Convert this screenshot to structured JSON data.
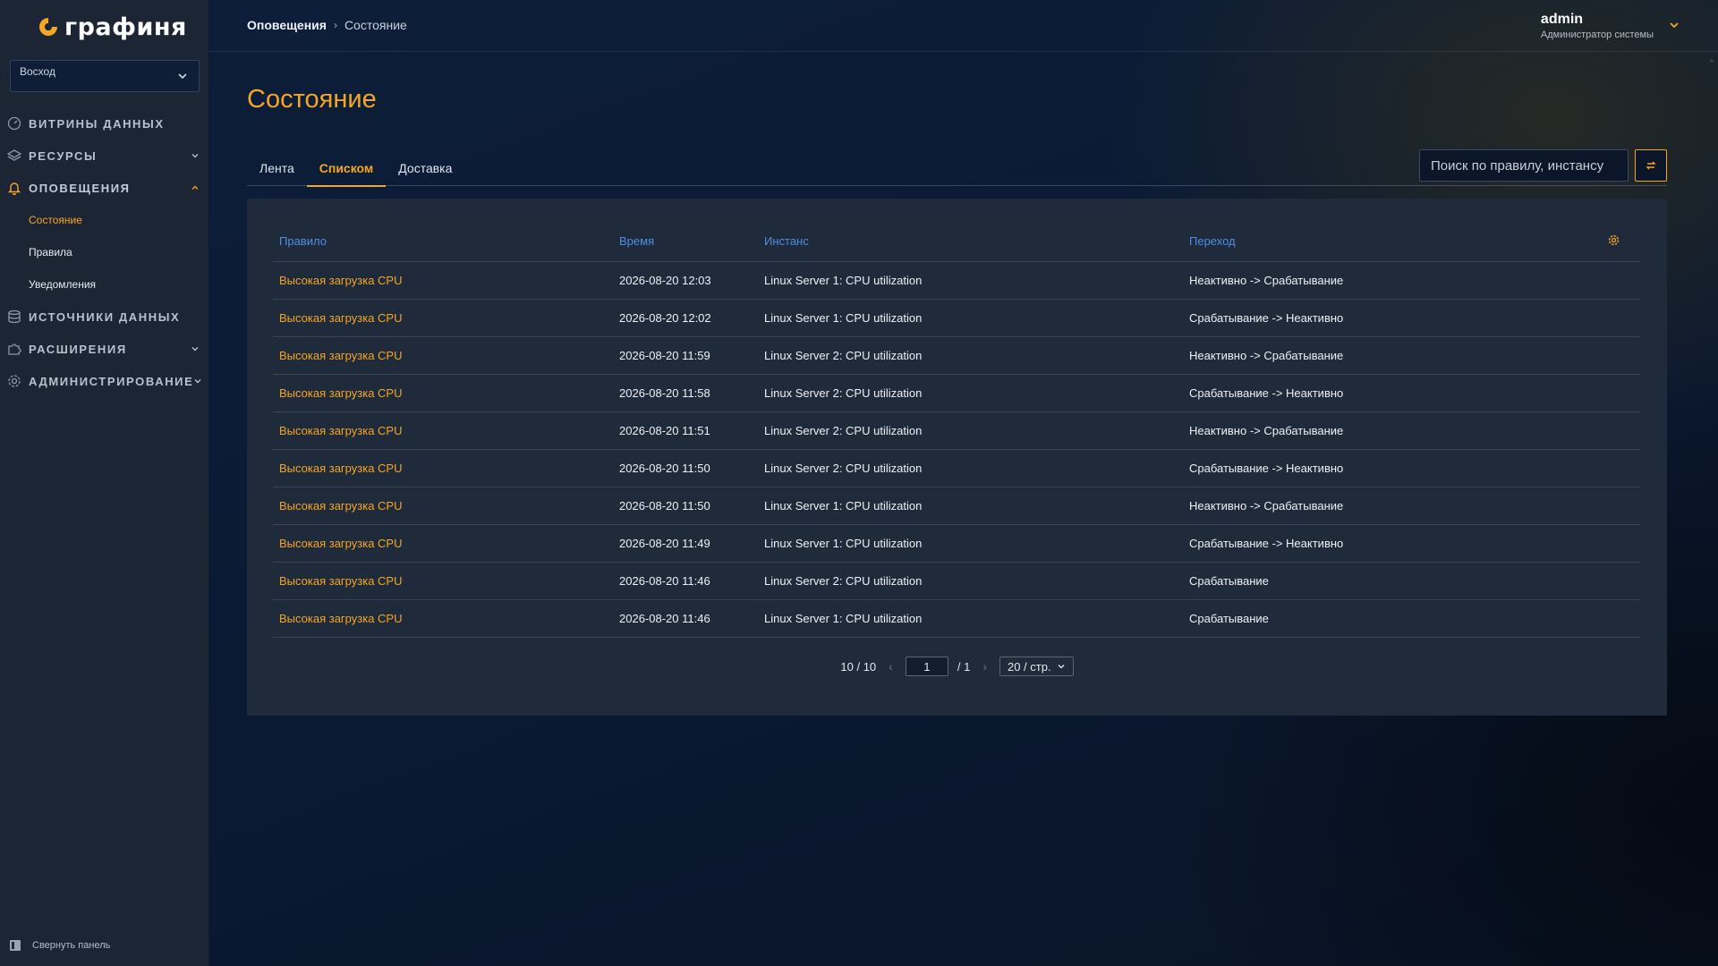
{
  "brand": {
    "logo_text": "графиня",
    "accent": "#f5a623"
  },
  "sidebar": {
    "org_select": {
      "value": "Восход"
    },
    "items": [
      {
        "label": "Витрины данных",
        "icon": "dashboard-icon",
        "expandable": false
      },
      {
        "label": "Ресурсы",
        "icon": "layers-icon",
        "expandable": true
      },
      {
        "label": "Оповещения",
        "icon": "bell-icon",
        "expandable": true,
        "expanded": true,
        "children": [
          {
            "label": "Состояние",
            "active": true
          },
          {
            "label": "Правила"
          },
          {
            "label": "Уведомления"
          }
        ]
      },
      {
        "label": "Источники данных",
        "icon": "database-icon",
        "expandable": false
      },
      {
        "label": "Расширения",
        "icon": "puzzle-icon",
        "expandable": true
      },
      {
        "label": "Администрирование",
        "icon": "gear-icon",
        "expandable": true
      }
    ],
    "collapse_label": "Свернуть панель"
  },
  "header": {
    "breadcrumb": [
      "Оповещения",
      "Состояние"
    ],
    "user": {
      "name": "admin",
      "role": "Администратор системы"
    }
  },
  "page": {
    "title": "Состояние",
    "tabs": [
      {
        "label": "Лента"
      },
      {
        "label": "Списком",
        "active": true
      },
      {
        "label": "Доставка"
      }
    ],
    "search_placeholder": "Поиск по правилу, инстансу"
  },
  "table": {
    "columns": [
      "Правило",
      "Время",
      "Инстанс",
      "Переход"
    ],
    "rows": [
      {
        "rule": "Высокая загрузка CPU",
        "time": "2026-08-20 12:03",
        "instance": "Linux Server 1: CPU utilization",
        "transition": "Неактивно -> Срабатывание"
      },
      {
        "rule": "Высокая загрузка CPU",
        "time": "2026-08-20 12:02",
        "instance": "Linux Server 1: CPU utilization",
        "transition": "Срабатывание -> Неактивно"
      },
      {
        "rule": "Высокая загрузка CPU",
        "time": "2026-08-20 11:59",
        "instance": "Linux Server 2: CPU utilization",
        "transition": "Неактивно -> Срабатывание"
      },
      {
        "rule": "Высокая загрузка CPU",
        "time": "2026-08-20 11:58",
        "instance": "Linux Server 2: CPU utilization",
        "transition": "Срабатывание -> Неактивно"
      },
      {
        "rule": "Высокая загрузка CPU",
        "time": "2026-08-20 11:51",
        "instance": "Linux Server 2: CPU utilization",
        "transition": "Неактивно -> Срабатывание"
      },
      {
        "rule": "Высокая загрузка CPU",
        "time": "2026-08-20 11:50",
        "instance": "Linux Server 2: CPU utilization",
        "transition": "Срабатывание -> Неактивно"
      },
      {
        "rule": "Высокая загрузка CPU",
        "time": "2026-08-20 11:50",
        "instance": "Linux Server 1: CPU utilization",
        "transition": "Неактивно -> Срабатывание"
      },
      {
        "rule": "Высокая загрузка CPU",
        "time": "2026-08-20 11:49",
        "instance": "Linux Server 1: CPU utilization",
        "transition": "Срабатывание -> Неактивно"
      },
      {
        "rule": "Высокая загрузка CPU",
        "time": "2026-08-20 11:46",
        "instance": "Linux Server 2: CPU utilization",
        "transition": "Срабатывание"
      },
      {
        "rule": "Высокая загрузка CPU",
        "time": "2026-08-20 11:46",
        "instance": "Linux Server 1: CPU utilization",
        "transition": "Срабатывание"
      }
    ]
  },
  "pagination": {
    "total": "10 / 10",
    "current_page": "1",
    "total_pages": "/ 1",
    "page_size": "20 / стр."
  }
}
